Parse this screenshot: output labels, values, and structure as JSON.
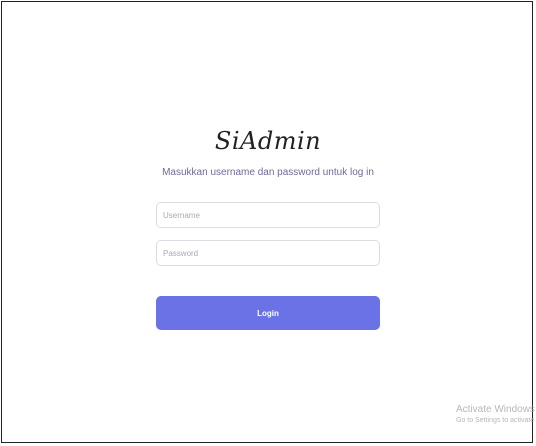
{
  "app": {
    "logo_text": "SiAdmin",
    "subtitle": "Masukkan username dan password untuk log in"
  },
  "form": {
    "username_placeholder": "Username",
    "username_value": "",
    "password_placeholder": "Password",
    "password_value": "",
    "login_label": "Login"
  },
  "watermark": {
    "title": "Activate Windows",
    "subtitle": "Go to Settings to activate"
  },
  "colors": {
    "accent": "#6a72e6",
    "subtitle": "#6b6b9a",
    "input_border": "#dcdde3"
  }
}
